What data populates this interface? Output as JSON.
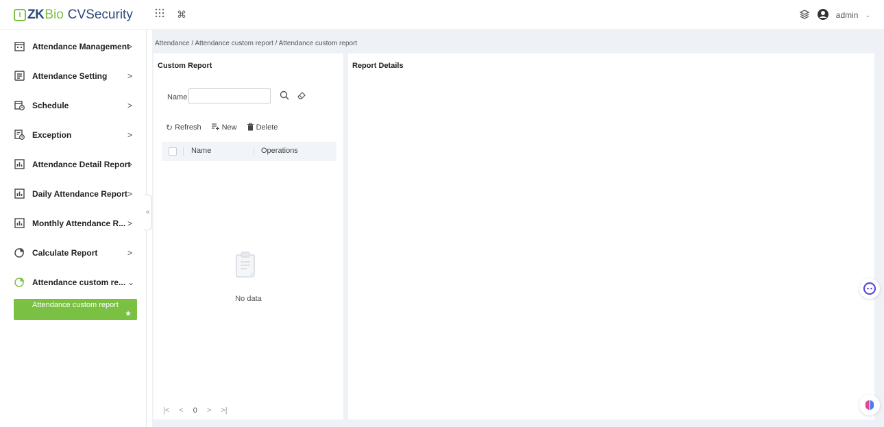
{
  "app": {
    "logo_mark": "I",
    "logo_zk": "ZK",
    "logo_bio": "Bio",
    "logo_product": "CVSecurity"
  },
  "header": {
    "user_name": "admin",
    "apps_icon": "grid-icon",
    "shortcut_icon": "command-icon",
    "layers_icon": "layers-icon",
    "user_icon": "user-icon"
  },
  "sidebar": {
    "items": [
      {
        "label": "Attendance Management",
        "arrow": ">",
        "icon": "calendar-icon"
      },
      {
        "label": "Attendance Setting",
        "arrow": ">",
        "icon": "settings-icon"
      },
      {
        "label": "Schedule",
        "arrow": ">",
        "icon": "schedule-icon"
      },
      {
        "label": "Exception",
        "arrow": ">",
        "icon": "exception-icon"
      },
      {
        "label": "Attendance Detail Report",
        "arrow": ">",
        "icon": "bar-chart-icon"
      },
      {
        "label": "Daily Attendance Report",
        "arrow": ">",
        "icon": "bar-chart-icon"
      },
      {
        "label": "Monthly Attendance R...",
        "arrow": ">",
        "icon": "bar-chart-icon"
      },
      {
        "label": "Calculate Report",
        "arrow": ">",
        "icon": "pie-chart-icon"
      },
      {
        "label": "Attendance custom re...",
        "arrow": "⌄",
        "icon": "pie-chart-icon"
      }
    ],
    "sub_item": {
      "label": "Attendance custom report",
      "star": "★"
    },
    "collapse": "«"
  },
  "breadcrumb": "Attendance / Attendance custom report / Attendance custom report",
  "left_panel": {
    "title": "Custom Report",
    "search_label": "Name",
    "search_value": "",
    "toolbar": {
      "refresh": "Refresh",
      "new": "New",
      "delete": "Delete"
    },
    "grid": {
      "columns": [
        "Name",
        "Operations"
      ]
    },
    "empty_text": "No data",
    "pager": {
      "first": "|<",
      "prev": "<",
      "page": "0",
      "next": ">",
      "last": ">|"
    }
  },
  "right_panel": {
    "title": "Report Details"
  },
  "colors": {
    "brand_green": "#7ac143",
    "brand_navy": "#2d4a7a",
    "background": "#eef2f6"
  }
}
